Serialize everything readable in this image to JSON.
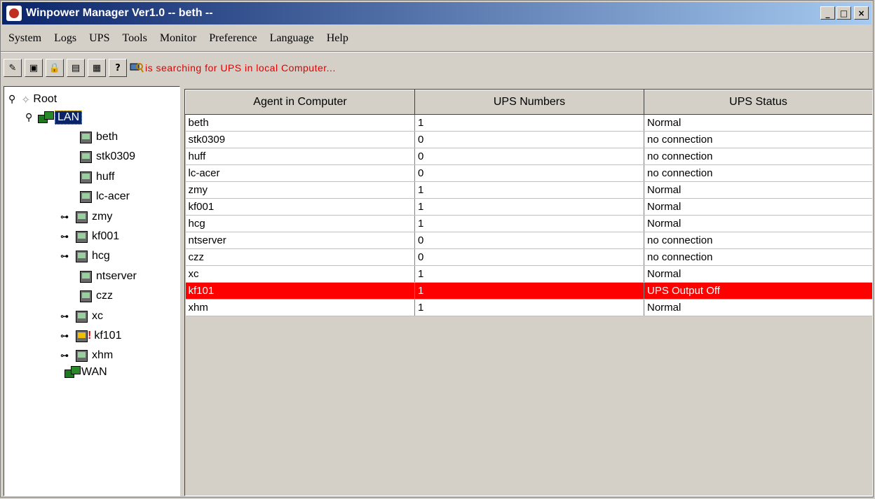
{
  "window": {
    "title": "Winpower Manager Ver1.0 -- beth --",
    "controls": {
      "minimize": "_",
      "maximize": "□",
      "close": "×"
    }
  },
  "menu": [
    "System",
    "Logs",
    "UPS",
    "Tools",
    "Monitor",
    "Preference",
    "Language",
    "Help"
  ],
  "toolbar": {
    "buttons": [
      {
        "icon": "wrench-icon",
        "glyph": "✎"
      },
      {
        "icon": "monitor-config-icon",
        "glyph": "▣"
      },
      {
        "icon": "lock-icon",
        "glyph": "🔒"
      },
      {
        "icon": "table-icon",
        "glyph": "▤"
      },
      {
        "icon": "calculator-icon",
        "glyph": "▦"
      },
      {
        "icon": "help-icon",
        "glyph": "?"
      }
    ],
    "search_icon": "search-computer-icon",
    "status_message": "is searching for UPS in local Computer..."
  },
  "tree": {
    "root": {
      "label": "Root"
    },
    "lan": {
      "label": "LAN"
    },
    "nodes": [
      {
        "label": "beth",
        "expandable": false,
        "alert": false
      },
      {
        "label": "stk0309",
        "expandable": false,
        "alert": false
      },
      {
        "label": "huff",
        "expandable": false,
        "alert": false
      },
      {
        "label": "lc-acer",
        "expandable": false,
        "alert": false
      },
      {
        "label": "zmy",
        "expandable": true,
        "alert": false
      },
      {
        "label": "kf001",
        "expandable": true,
        "alert": false
      },
      {
        "label": "hcg",
        "expandable": true,
        "alert": false
      },
      {
        "label": "ntserver",
        "expandable": false,
        "alert": false
      },
      {
        "label": "czz",
        "expandable": false,
        "alert": false
      },
      {
        "label": "xc",
        "expandable": true,
        "alert": false
      },
      {
        "label": "kf101",
        "expandable": true,
        "alert": true
      },
      {
        "label": "xhm",
        "expandable": true,
        "alert": false
      }
    ],
    "wan": {
      "label": "WAN"
    }
  },
  "table": {
    "headers": [
      "Agent in Computer",
      "UPS Numbers",
      "UPS Status"
    ],
    "rows": [
      {
        "agent": "beth",
        "ups": "1",
        "status": "Normal"
      },
      {
        "agent": "stk0309",
        "ups": "0",
        "status": "no connection"
      },
      {
        "agent": "huff",
        "ups": "0",
        "status": "no connection"
      },
      {
        "agent": "lc-acer",
        "ups": "0",
        "status": "no connection"
      },
      {
        "agent": "zmy",
        "ups": "1",
        "status": "Normal"
      },
      {
        "agent": "kf001",
        "ups": "1",
        "status": "Normal"
      },
      {
        "agent": "hcg",
        "ups": "1",
        "status": "Normal"
      },
      {
        "agent": "ntserver",
        "ups": "0",
        "status": "no connection"
      },
      {
        "agent": "czz",
        "ups": "0",
        "status": "no connection"
      },
      {
        "agent": "xc",
        "ups": "1",
        "status": "Normal"
      },
      {
        "agent": "kf101",
        "ups": "1",
        "status": "UPS Output Off",
        "alert": true
      },
      {
        "agent": "xhm",
        "ups": "1",
        "status": "Normal"
      }
    ]
  },
  "colors": {
    "alert_row": "#ff0000",
    "status_message": "#e00000",
    "titlebar": "#0a246a"
  }
}
